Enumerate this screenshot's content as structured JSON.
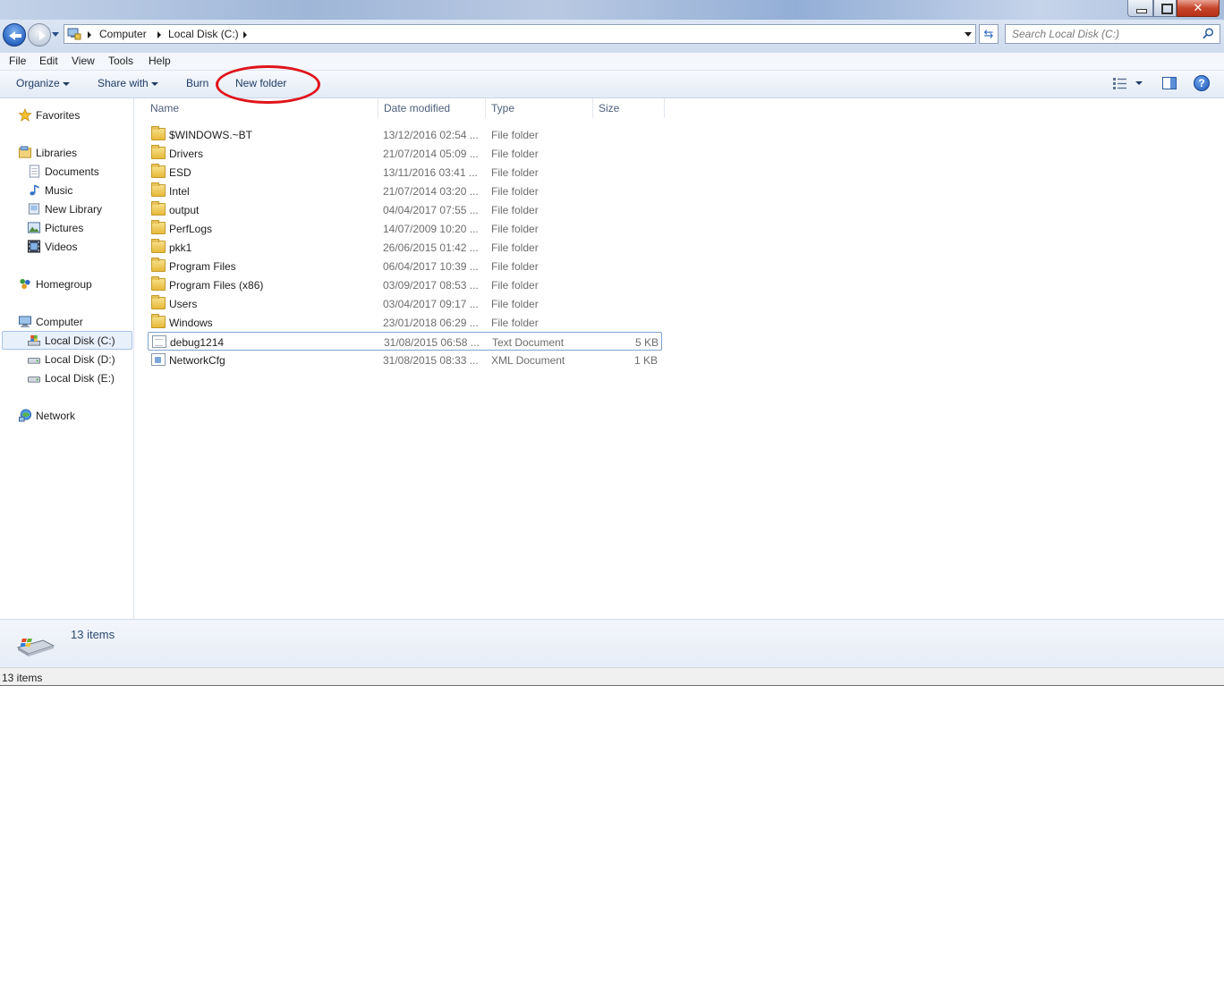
{
  "window": {
    "close_glyph": "✕"
  },
  "address": {
    "crumbs": [
      "Computer",
      "Local Disk (C:)"
    ],
    "refresh_glyph": "⇆"
  },
  "search": {
    "placeholder": "Search Local Disk (C:)"
  },
  "menu": [
    "File",
    "Edit",
    "View",
    "Tools",
    "Help"
  ],
  "toolbar": {
    "organize": "Organize",
    "share_with": "Share with",
    "burn": "Burn",
    "new_folder": "New folder",
    "help_glyph": "?"
  },
  "annotation": {
    "color": "#e0141b",
    "shape": "ellipse around New folder button"
  },
  "nav": {
    "favorites": "Favorites",
    "libraries": "Libraries",
    "documents": "Documents",
    "music": "Music",
    "new_library": "New Library",
    "pictures": "Pictures",
    "videos": "Videos",
    "homegroup": "Homegroup",
    "computer": "Computer",
    "local_c": "Local Disk (C:)",
    "local_d": "Local Disk (D:)",
    "local_e": "Local Disk (E:)",
    "network": "Network"
  },
  "columns": {
    "name": "Name",
    "date": "Date modified",
    "type": "Type",
    "size": "Size"
  },
  "files": [
    {
      "name": "$WINDOWS.~BT",
      "date": "13/12/2016 02:54 ...",
      "type": "File folder",
      "size": "",
      "icon": "folder-icon"
    },
    {
      "name": "Drivers",
      "date": "21/07/2014 05:09 ...",
      "type": "File folder",
      "size": "",
      "icon": "folder-icon"
    },
    {
      "name": "ESD",
      "date": "13/11/2016 03:41 ...",
      "type": "File folder",
      "size": "",
      "icon": "folder-icon"
    },
    {
      "name": "Intel",
      "date": "21/07/2014 03:20 ...",
      "type": "File folder",
      "size": "",
      "icon": "folder-icon"
    },
    {
      "name": "output",
      "date": "04/04/2017 07:55 ...",
      "type": "File folder",
      "size": "",
      "icon": "folder-icon"
    },
    {
      "name": "PerfLogs",
      "date": "14/07/2009 10:20 ...",
      "type": "File folder",
      "size": "",
      "icon": "folder-icon"
    },
    {
      "name": "pkk1",
      "date": "26/06/2015 01:42 ...",
      "type": "File folder",
      "size": "",
      "icon": "folder-icon"
    },
    {
      "name": "Program Files",
      "date": "06/04/2017 10:39 ...",
      "type": "File folder",
      "size": "",
      "icon": "folder-icon"
    },
    {
      "name": "Program Files (x86)",
      "date": "03/09/2017 08:53 ...",
      "type": "File folder",
      "size": "",
      "icon": "folder-icon"
    },
    {
      "name": "Users",
      "date": "03/04/2017 09:17 ...",
      "type": "File folder",
      "size": "",
      "icon": "folder-icon"
    },
    {
      "name": "Windows",
      "date": "23/01/2018 06:29 ...",
      "type": "File folder",
      "size": "",
      "icon": "folder-icon"
    },
    {
      "name": "debug1214",
      "date": "31/08/2015 06:58 ...",
      "type": "Text Document",
      "size": "5 KB",
      "icon": "text-document-icon"
    },
    {
      "name": "NetworkCfg",
      "date": "31/08/2015 08:33 ...",
      "type": "XML Document",
      "size": "1 KB",
      "icon": "xml-document-icon"
    }
  ],
  "details": {
    "count": "13 items"
  },
  "status": {
    "text": "13 items"
  }
}
